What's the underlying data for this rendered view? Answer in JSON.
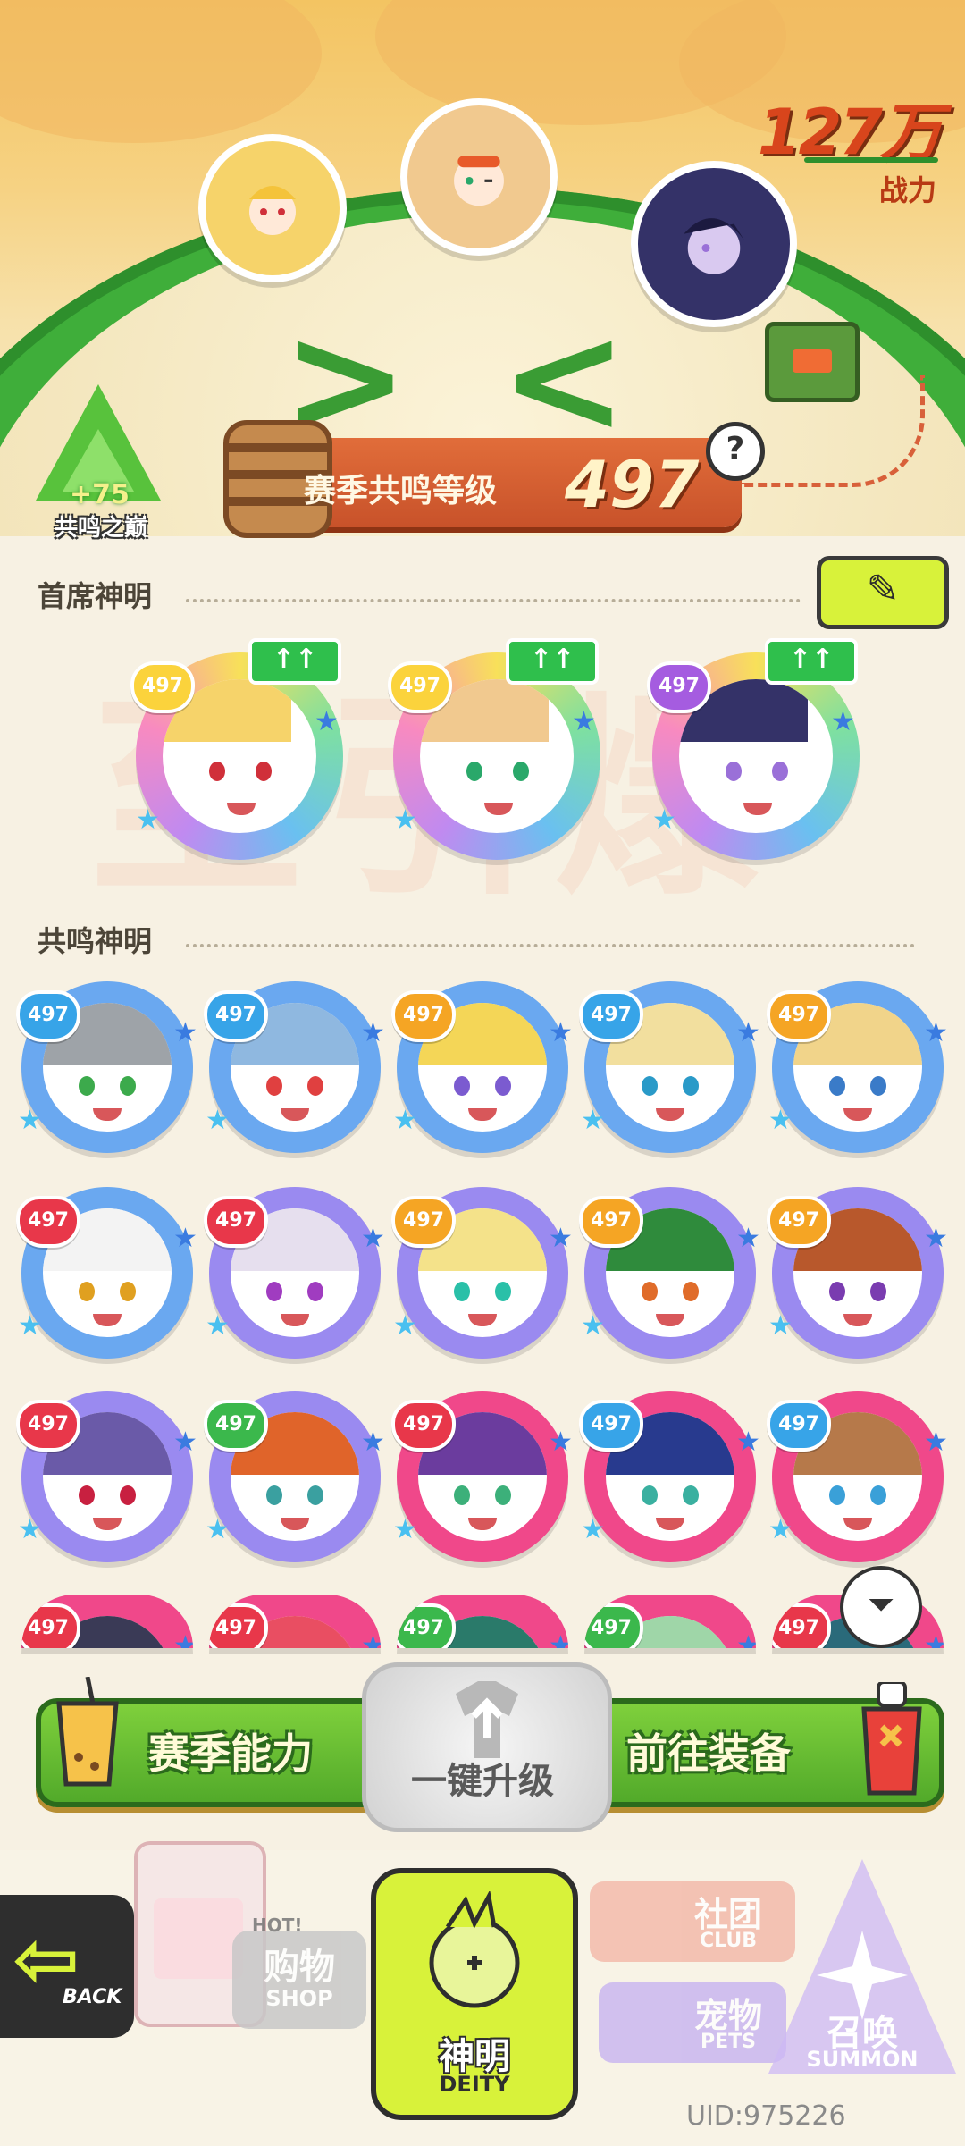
{
  "header": {
    "power_value": "127万",
    "power_label": "战力",
    "peak_bonus": "+75",
    "peak_label": "共鸣之巅",
    "level_label": "赛季共鸣等级",
    "level_value": "497",
    "help_icon": "?"
  },
  "chief_section": {
    "title": "首席神明",
    "edit_icon": "✎",
    "watermark": "至引爆",
    "deities": [
      {
        "level": "497",
        "ring": "#fbd33c",
        "hair": "#f6d36a",
        "eye": "#d0303a",
        "up": "↑↑"
      },
      {
        "level": "497",
        "ring": "#fbd33c",
        "hair": "#f1c98f",
        "eye": "#2aa86a",
        "up": "↑↑"
      },
      {
        "level": "497",
        "ring": "#a55ce0",
        "hair": "#343268",
        "eye": "#9a70d8",
        "up": "↑↑"
      }
    ]
  },
  "resonance_section": {
    "title": "共鸣神明",
    "rows": [
      [
        {
          "level": "497",
          "badge": "#37a4e8",
          "ring": "#6aa8f0",
          "hair": "#9ea3a8",
          "eye": "#3caa4c"
        },
        {
          "level": "497",
          "badge": "#37a4e8",
          "ring": "#6aa8f0",
          "hair": "#8fb8e0",
          "eye": "#e04040"
        },
        {
          "level": "497",
          "badge": "#f5a524",
          "ring": "#6aa8f0",
          "hair": "#f4d657",
          "eye": "#7b5bd0"
        },
        {
          "level": "497",
          "badge": "#37a4e8",
          "ring": "#6aa8f0",
          "hair": "#f2df9e",
          "eye": "#2a9ac8"
        },
        {
          "level": "497",
          "badge": "#f5a524",
          "ring": "#6aa8f0",
          "hair": "#f1d48a",
          "eye": "#3a7bc8"
        }
      ],
      [
        {
          "level": "497",
          "badge": "#e8374a",
          "ring": "#6aa8f0",
          "hair": "#f3f3f3",
          "eye": "#e0a020"
        },
        {
          "level": "497",
          "badge": "#e8374a",
          "ring": "#9a8af0",
          "hair": "#e6dfee",
          "eye": "#a03cc0"
        },
        {
          "level": "497",
          "badge": "#f5a524",
          "ring": "#9a8af0",
          "hair": "#f4e28a",
          "eye": "#2ac0a8"
        },
        {
          "level": "497",
          "badge": "#f5a524",
          "ring": "#9a8af0",
          "hair": "#2f8b3c",
          "eye": "#e06c2a"
        },
        {
          "level": "497",
          "badge": "#f5a524",
          "ring": "#9a8af0",
          "hair": "#b8582c",
          "eye": "#7a3cb0"
        }
      ],
      [
        {
          "level": "497",
          "badge": "#e8374a",
          "ring": "#9a8af0",
          "hair": "#6a5aa8",
          "eye": "#c82040"
        },
        {
          "level": "497",
          "badge": "#3bb84c",
          "ring": "#9a8af0",
          "hair": "#e0642a",
          "eye": "#3aa0a0"
        },
        {
          "level": "497",
          "badge": "#e8374a",
          "ring": "#f0488a",
          "hair": "#6b3c9e",
          "eye": "#3cb07a"
        },
        {
          "level": "497",
          "badge": "#37a4e8",
          "ring": "#f0488a",
          "hair": "#283a8e",
          "eye": "#3ab0a0"
        },
        {
          "level": "497",
          "badge": "#37a4e8",
          "ring": "#f0488a",
          "hair": "#b6794a",
          "eye": "#3aa0d8"
        }
      ],
      [
        {
          "level": "497",
          "badge": "#e8374a",
          "ring": "#f0488a",
          "hair": "#3a3a56",
          "eye": "#333"
        },
        {
          "level": "497",
          "badge": "#e8374a",
          "ring": "#f0488a",
          "hair": "#e94e62",
          "eye": "#333"
        },
        {
          "level": "497",
          "badge": "#3bb84c",
          "ring": "#f0488a",
          "hair": "#2a7a6a",
          "eye": "#333"
        },
        {
          "level": "497",
          "badge": "#3bb84c",
          "ring": "#f0488a",
          "hair": "#9fd6a8",
          "eye": "#333"
        },
        {
          "level": "497",
          "badge": "#e8374a",
          "ring": "#f0488a",
          "hair": "#2a6a7a",
          "eye": "#333"
        }
      ]
    ],
    "filter_icon": "⏷"
  },
  "actions": {
    "season_ability": "赛季能力",
    "one_click_upgrade": "一键升级",
    "go_equipment": "前往装备"
  },
  "nav": {
    "back_icon": "⇦",
    "back_label": "BACK",
    "hot_tag": "HOT!",
    "shop_cn": "购物",
    "shop_en": "SHOP",
    "deity_cn": "神明",
    "deity_en": "DEITY",
    "club_cn": "社团",
    "club_en": "CLUB",
    "pets_cn": "宠物",
    "pets_en": "PETS",
    "summon_cn": "召唤",
    "summon_en": "SUMMON",
    "uid": "UID:975226"
  },
  "colors": {
    "accent_green": "#52aa2a",
    "accent_lime": "#d8f23a",
    "level_orange": "#d05a2c"
  }
}
